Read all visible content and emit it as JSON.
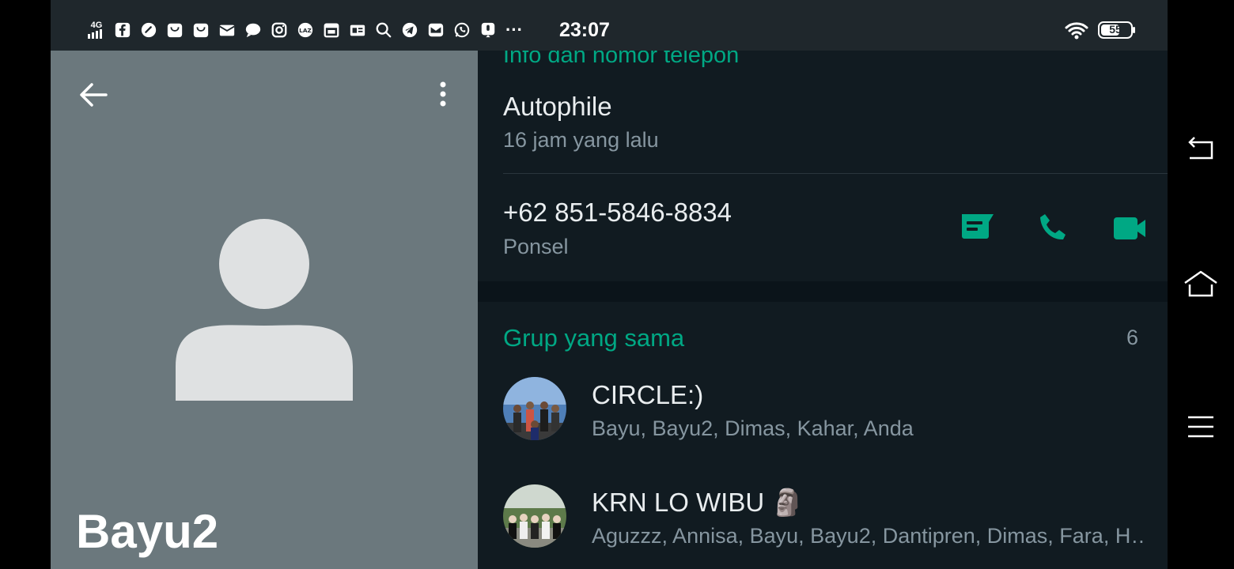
{
  "status_bar": {
    "network_label": "4G",
    "time": "23:07",
    "battery_level": "55",
    "icons": [
      "signal-icon",
      "facebook-icon",
      "speedometer-icon",
      "shopping-bag-icon",
      "shopping-bag-icon",
      "mail-icon",
      "chat-icon",
      "instagram-icon",
      "lazada-icon",
      "calendar-icon",
      "news-icon",
      "search-icon",
      "telegram-icon",
      "email-icon",
      "whatsapp-icon",
      "microphone-icon",
      "more-icon"
    ],
    "more_label": "···"
  },
  "profile": {
    "name": "Bayu2"
  },
  "info_section": {
    "title": "Info dan nomor telepon",
    "about": "Autophile",
    "about_time": "16 jam yang lalu",
    "phone": "+62 851-5846-8834",
    "phone_type": "Ponsel"
  },
  "groups_section": {
    "title": "Grup yang sama",
    "count": "6",
    "groups": [
      {
        "name": "CIRCLE:)",
        "members": "Bayu, Bayu2, Dimas, Kahar, Anda"
      },
      {
        "name": "KRN LO WIBU 🗿",
        "members": "Aguzzz, Annisa, Bayu, Bayu2, Dantipren, Dimas, Fara, H…"
      }
    ]
  },
  "colors": {
    "accent": "#00a884",
    "profile_bg": "#6b787d",
    "pane_bg": "#111b21",
    "status_bg": "#1f272c"
  }
}
